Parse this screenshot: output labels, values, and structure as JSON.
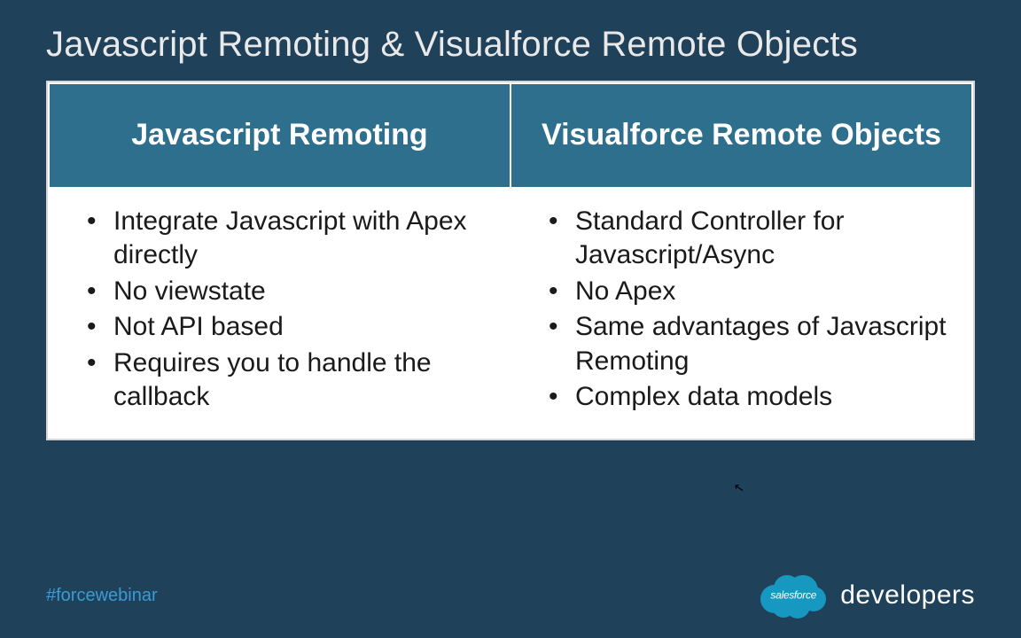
{
  "slide": {
    "title": "Javascript Remoting & Visualforce Remote Objects"
  },
  "table": {
    "headers": {
      "left": "Javascript Remoting",
      "right": "Visualforce Remote Objects"
    },
    "left_items": [
      "Integrate Javascript with Apex directly",
      "No viewstate",
      "Not API based",
      "Requires you to handle the callback"
    ],
    "right_items": [
      "Standard Controller for Javascript/Async",
      "No Apex",
      "Same advantages of Javascript Remoting",
      "Complex data models"
    ]
  },
  "footer": {
    "hashtag": "#forcewebinar",
    "cloud_label": "salesforce",
    "brand_text": "developers"
  }
}
